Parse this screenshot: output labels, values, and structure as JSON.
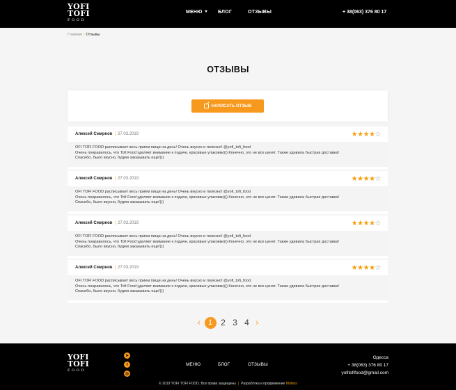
{
  "header": {
    "logo": {
      "line1": "YOFI",
      "line2": "TOFI",
      "line3": "FOOD"
    },
    "nav": [
      "МЕНЮ",
      "БЛОГ",
      "ОТЗЫВЫ"
    ],
    "phone": "+ 38(063) 376 80 17"
  },
  "breadcrumb": {
    "home": "Главная",
    "separator": "/",
    "current": "Отзывы"
  },
  "page": {
    "title": "ОТЗЫВЫ",
    "write_button": "НАПИСАТЬ ОТЗЫВ"
  },
  "reviews": [
    {
      "author": "Алексей Смирнов",
      "date": "27.03.2019",
      "rating": 4,
      "max_rating": 5,
      "lines": [
        "OFI TOFI FOOD расписывает весь прием пищи на день! Очень вкусно и полезно! @yofi_tofi_food",
        "Очень понравилось, что Tofi Food уделяет внимание к подаче, красивые упаковки))) Конечно, это не все ценят. Также удивила быстрая доставка!",
        "Спасибо, было вкусно, будем заказывать еще!)))"
      ]
    },
    {
      "author": "Алексей Смирнов",
      "date": "27.03.2019",
      "rating": 4,
      "max_rating": 5,
      "lines": [
        "OFI TOFI FOOD расписывает весь прием пищи на день! Очень вкусно и полезно! @yofi_tofi_food",
        "Очень понравилось, что Tofi Food уделяет внимание к подаче, красивые упаковки))) Конечно, это не все ценят. Также удивила быстрая доставка!",
        "Спасибо, было вкусно, будем заказывать еще!)))"
      ]
    },
    {
      "author": "Алексей Смирнов",
      "date": "27.03.2019",
      "rating": 4,
      "max_rating": 5,
      "lines": [
        "OFI TOFI FOOD расписывает весь прием пищи на день! Очень вкусно и полезно! @yofi_tofi_food",
        "Очень понравилось, что Tofi Food уделяет внимание к подаче, красивые упаковки))) Конечно, это не все ценят. Также удивила быстрая доставка!",
        "Спасибо, было вкусно, будем заказывать еще!)))"
      ]
    },
    {
      "author": "Алексей Смирнов",
      "date": "27.03.2019",
      "rating": 4,
      "max_rating": 5,
      "lines": [
        "OFI TOFI FOOD расписывает весь прием пищи на день! Очень вкусно и полезно! @yofi_tofi_food",
        "Очень понравилось, что Tofi Food уделяет внимание к подаче, красивые упаковки))) Конечно, это не все ценят. Также удивила быстрая доставка!",
        "Спасибо, было вкусно, будем заказывать еще!)))"
      ]
    }
  ],
  "pagination": {
    "prev": "‹",
    "next": "›",
    "pages": [
      "1",
      "2",
      "3",
      "4"
    ],
    "active": "1"
  },
  "footer": {
    "logo": {
      "line1": "YOFI",
      "line2": "TOFI",
      "line3": "FOOD"
    },
    "social_icons": [
      "telegram-icon",
      "facebook-icon",
      "instagram-icon"
    ],
    "nav": [
      "МЕНЮ",
      "БЛОГ",
      "ОТЗЫВЫ"
    ],
    "city": "Одесса",
    "phone": "+ 38(063) 376 80 17",
    "email": "yofitofifood@gmail.com",
    "copyright": "© 2019 YOFI TOFI FOOD. Все права защищены",
    "dev_text": "Разработка и продвижение",
    "dev_brand": "Mobios"
  },
  "colors": {
    "accent": "#f7991c",
    "header_bg": "#000000",
    "page_bg": "#f5f5f5"
  }
}
